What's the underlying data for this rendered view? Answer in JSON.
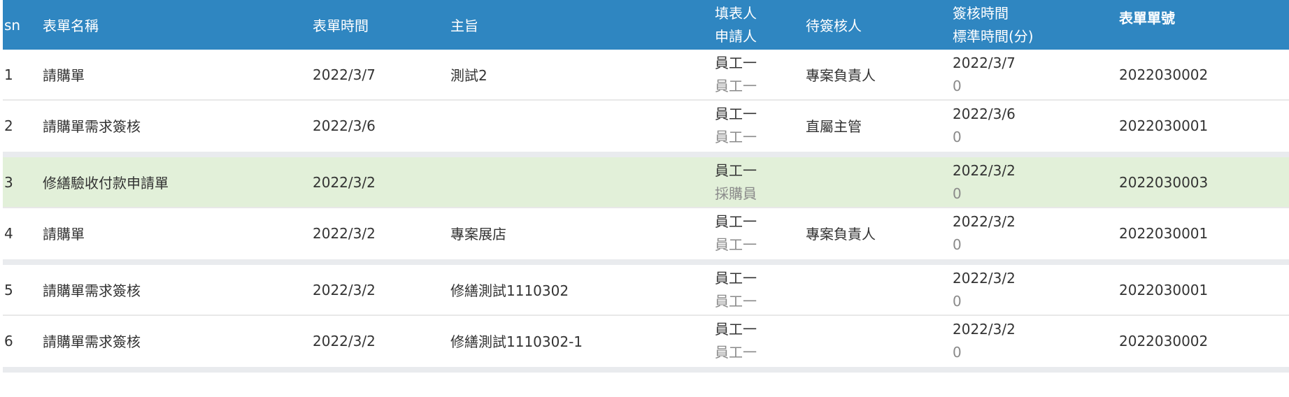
{
  "header": {
    "sn": "sn",
    "form_name": "表單名稱",
    "form_date": "表單時間",
    "subject": "主旨",
    "filler_line1": "填表人",
    "filler_line2": "申請人",
    "pending_approver": "待簽核人",
    "sign_time_line1": "簽核時間",
    "sign_time_line2": "標準時間(分)",
    "form_number": "表單單號"
  },
  "rows": [
    {
      "sn": "1",
      "form_name": "請購單",
      "form_date": "2022/3/7",
      "subject": "測試2",
      "filler": "員工一",
      "applicant": "員工一",
      "pending_approver": "專案負責人",
      "sign_time": "2022/3/7",
      "standard_minutes": "0",
      "form_number": "2022030002"
    },
    {
      "sn": "2",
      "form_name": "請購單需求簽核",
      "form_date": "2022/3/6",
      "subject": "",
      "filler": "員工一",
      "applicant": "員工一",
      "pending_approver": "直屬主管",
      "sign_time": "2022/3/6",
      "standard_minutes": "0",
      "form_number": "2022030001"
    },
    {
      "sn": "3",
      "form_name": "修繕驗收付款申請單",
      "form_date": "2022/3/2",
      "subject": "",
      "filler": "員工一",
      "applicant": "採購員",
      "pending_approver": "",
      "sign_time": "2022/3/2",
      "standard_minutes": "0",
      "form_number": "2022030003"
    },
    {
      "sn": "4",
      "form_name": "請購單",
      "form_date": "2022/3/2",
      "subject": "專案展店",
      "filler": "員工一",
      "applicant": "員工一",
      "pending_approver": "專案負責人",
      "sign_time": "2022/3/2",
      "standard_minutes": "0",
      "form_number": "2022030001"
    },
    {
      "sn": "5",
      "form_name": "請購單需求簽核",
      "form_date": "2022/3/2",
      "subject": "修繕測試1110302",
      "filler": "員工一",
      "applicant": "員工一",
      "pending_approver": "",
      "sign_time": "2022/3/2",
      "standard_minutes": "0",
      "form_number": "2022030001"
    },
    {
      "sn": "6",
      "form_name": "請購單需求簽核",
      "form_date": "2022/3/2",
      "subject": "修繕測試1110302-1",
      "filler": "員工一",
      "applicant": "員工一",
      "pending_approver": "",
      "sign_time": "2022/3/2",
      "standard_minutes": "0",
      "form_number": "2022030002"
    }
  ],
  "colors": {
    "header_bg": "#2f86c1",
    "highlight_row_bg": "#e2f0d9"
  }
}
